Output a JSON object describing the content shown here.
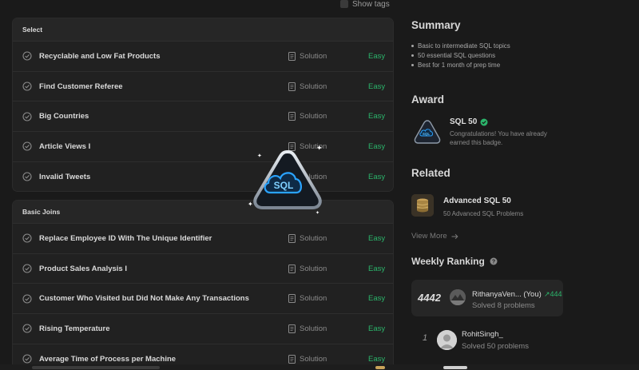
{
  "show_tags": "Show tags",
  "groups": [
    {
      "name": "Select",
      "problems": [
        {
          "title": "Recyclable and Low Fat Products",
          "solution": "Solution",
          "difficulty": "Easy"
        },
        {
          "title": "Find Customer Referee",
          "solution": "Solution",
          "difficulty": "Easy"
        },
        {
          "title": "Big Countries",
          "solution": "Solution",
          "difficulty": "Easy"
        },
        {
          "title": "Article Views I",
          "solution": "Solution",
          "difficulty": "Easy"
        },
        {
          "title": "Invalid Tweets",
          "solution": "Solution",
          "difficulty": "Easy"
        }
      ]
    },
    {
      "name": "Basic Joins",
      "problems": [
        {
          "title": "Replace Employee ID With The Unique Identifier",
          "solution": "Solution",
          "difficulty": "Easy"
        },
        {
          "title": "Product Sales Analysis I",
          "solution": "Solution",
          "difficulty": "Easy"
        },
        {
          "title": "Customer Who Visited but Did Not Make Any Transactions",
          "solution": "Solution",
          "difficulty": "Easy"
        },
        {
          "title": "Rising Temperature",
          "solution": "Solution",
          "difficulty": "Easy"
        },
        {
          "title": "Average Time of Process per Machine",
          "solution": "Solution",
          "difficulty": "Easy"
        }
      ]
    }
  ],
  "summary": {
    "heading": "Summary",
    "points": [
      "Basic to intermediate SQL topics",
      "50 essential SQL questions",
      "Best for 1 month of prep time"
    ]
  },
  "award": {
    "heading": "Award",
    "badge_text": "SQL",
    "title": "SQL 50",
    "description": "Congratulations! You have already earned this badge."
  },
  "related": {
    "heading": "Related",
    "title": "Advanced SQL 50",
    "subtitle": "50 Advanced SQL Problems",
    "view_more": "View More"
  },
  "ranking": {
    "heading": "Weekly Ranking",
    "me": {
      "rank": "4442",
      "name": "RithanyaVen... (You)",
      "solved": "Solved 8 problems",
      "delta": "444"
    },
    "top": {
      "rank": "1",
      "name": "RohitSingh_",
      "solved": "Solved 50 problems"
    }
  },
  "overlay_badge_text": "SQL",
  "colors": {
    "easy": "#2bb56b",
    "background": "#1a1a1a",
    "card": "#212121",
    "badge_glow": "#2aa3ff"
  }
}
